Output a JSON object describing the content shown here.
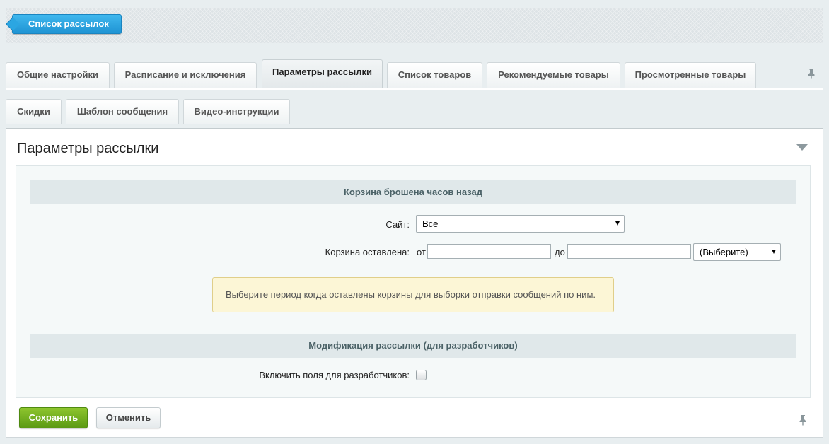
{
  "toolbar": {
    "back_label": "Список рассылок"
  },
  "tabs": {
    "row1": [
      "Общие настройки",
      "Расписание и исключения",
      "Параметры рассылки",
      "Список товаров",
      "Рекомендуемые товары",
      "Просмотренные товары"
    ],
    "row2": [
      "Скидки",
      "Шаблон сообщения",
      "Видео-инструкции"
    ],
    "active": "Параметры рассылки"
  },
  "panel": {
    "title": "Параметры рассылки",
    "section1_title": "Корзина брошена часов назад",
    "site_label": "Сайт:",
    "site_value": "Все",
    "cart_label": "Корзина оставлена:",
    "from_label": "от",
    "from_value": "",
    "to_label": "до",
    "to_value": "",
    "unit_value": "(Выберите)",
    "notice": "Выберите период когда оставлены корзины для выборки отправки сообщений по ним.",
    "section2_title": "Модификация рассылки (для разработчиков)",
    "dev_fields_label": "Включить поля для разработчиков:",
    "dev_fields_checked": false
  },
  "buttons": {
    "save": "Сохранить",
    "cancel": "Отменить"
  },
  "icons": {
    "pin": "pin-icon",
    "collapse": "chevron-down-icon"
  }
}
